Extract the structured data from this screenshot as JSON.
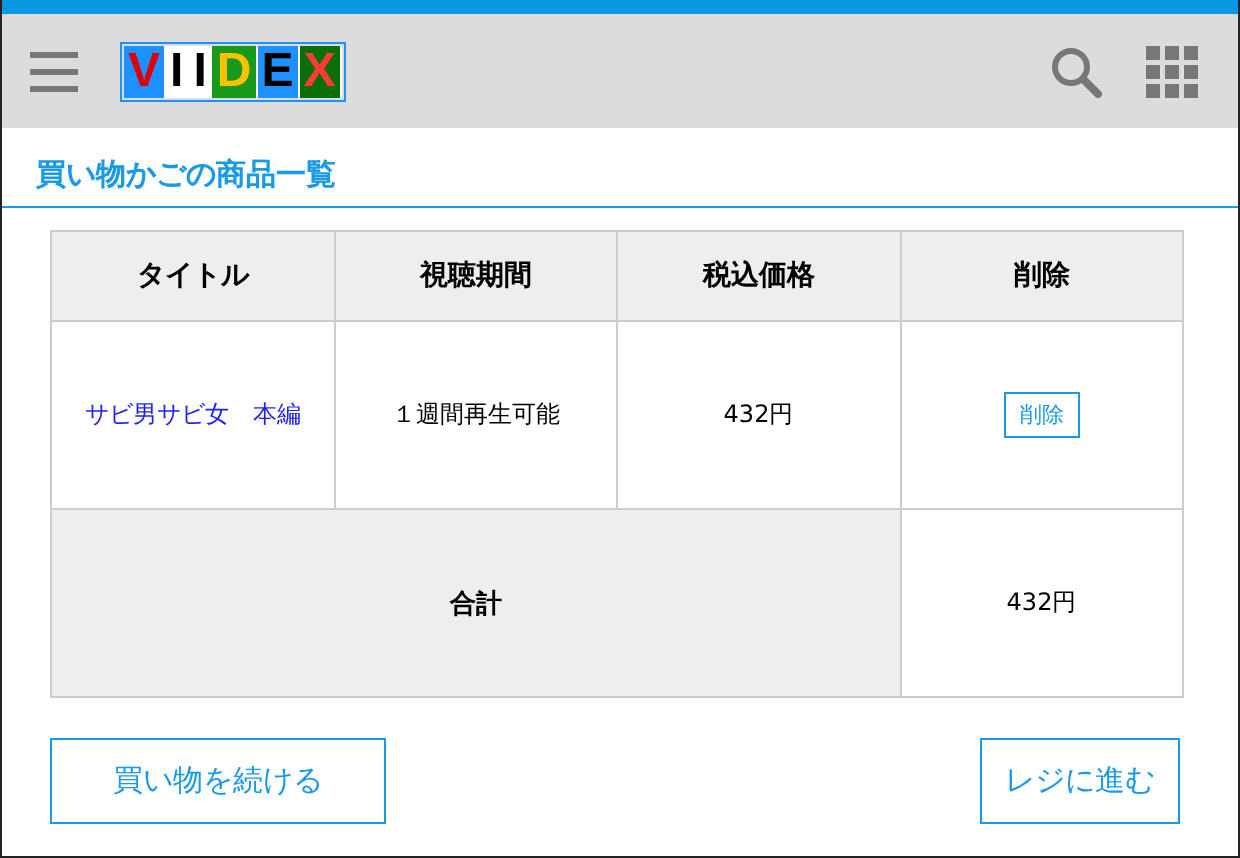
{
  "logo": {
    "text": "VIIDEX"
  },
  "page_title": "買い物かごの商品一覧",
  "table": {
    "columns": [
      "タイトル",
      "視聴期間",
      "税込価格",
      "削除"
    ],
    "rows": [
      {
        "title": "サビ男サビ女　本編",
        "period": "１週間再生可能",
        "price": "432円",
        "delete_button": "削除"
      }
    ],
    "total": {
      "label": "合計",
      "price": "432円"
    }
  },
  "buttons": {
    "continue": "買い物を続ける",
    "checkout": "レジに進む"
  }
}
